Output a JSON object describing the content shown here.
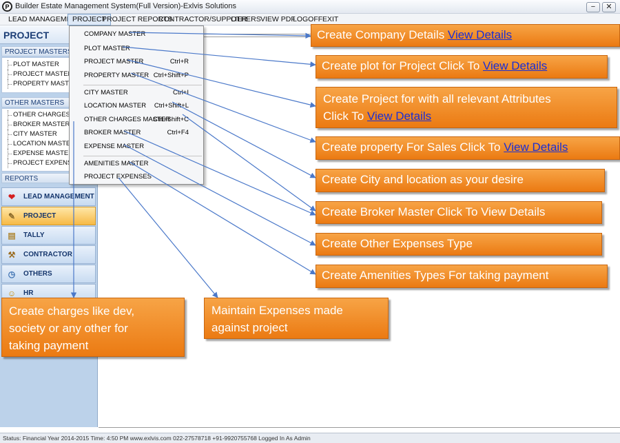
{
  "window": {
    "title": "Builder Estate Management System(Full Version)-Exlvis Solutions",
    "logo_glyph": "P",
    "minimize_glyph": "−",
    "close_glyph": "✕"
  },
  "menubar": {
    "items": [
      "LEAD MANAGEMENT",
      "PROJECT",
      "PROJECT REPORTS",
      "CONTRACTOR/SUPPLIER",
      "OTHERS",
      "VIEW PDF",
      "LOGOFF",
      "EXIT"
    ],
    "active": "PROJECT"
  },
  "sidebar": {
    "header": "PROJECT",
    "project_masters_label": "PROJECT MASTERS",
    "project_masters": [
      "PLOT MASTER",
      "PROJECT MASTER",
      "PROPERTY MASTER"
    ],
    "other_masters_label": "OTHER MASTERS",
    "other_masters": [
      "OTHER CHARGES MA",
      "BROKER MASTER",
      "CITY MASTER",
      "LOCATION MASTER",
      "EXPENSE MASTER",
      "PROJECT EXPENSES"
    ],
    "reports_label": "REPORTS",
    "nav": [
      {
        "label": "LEAD MANAGEMENT",
        "icon": "heart-icon",
        "glyph": "❤",
        "color": "#d42020"
      },
      {
        "label": "PROJECT",
        "icon": "tools-icon",
        "glyph": "✎",
        "color": "#8a6a2a"
      },
      {
        "label": "TALLY",
        "icon": "book-icon",
        "glyph": "▤",
        "color": "#b08a3a"
      },
      {
        "label": "CONTRACTOR",
        "icon": "hammer-icon",
        "glyph": "⚒",
        "color": "#9a6b1e"
      },
      {
        "label": "OTHERS",
        "icon": "clock-icon",
        "glyph": "◷",
        "color": "#3a6fb0"
      },
      {
        "label": "HR",
        "icon": "people-icon",
        "glyph": "☺",
        "color": "#c58a00"
      }
    ],
    "active_nav": "PROJECT"
  },
  "dropdown": {
    "items": [
      {
        "label": "COMPANY MASTER",
        "shortcut": ""
      },
      {
        "label": "PLOT MASTER",
        "shortcut": ""
      },
      {
        "label": "PROJECT MASTER",
        "shortcut": "Ctrl+R"
      },
      {
        "label": "PROPERTY MASTER",
        "shortcut": "Ctrl+Shift+P"
      },
      {
        "label": "CITY MASTER",
        "shortcut": "Ctrl+I"
      },
      {
        "label": "LOCATION MASTER",
        "shortcut": "Ctrl+Shift+L"
      },
      {
        "label": "OTHER CHARGES MASTER",
        "shortcut": "Ctrl+Shift+C"
      },
      {
        "label": "BROKER MASTER",
        "shortcut": "Ctrl+F4"
      },
      {
        "label": "EXPENSE MASTER",
        "shortcut": ""
      },
      {
        "label": "AMENITIES MASTER",
        "shortcut": ""
      },
      {
        "label": "PROJECT EXPENSES",
        "shortcut": ""
      }
    ]
  },
  "callouts": {
    "company": {
      "text": "Create Company Details ",
      "link": "View Details"
    },
    "plot": {
      "text": "Create plot for Project Click To ",
      "link": "View Details"
    },
    "project": {
      "line1": "Create Project for  with all relevant Attributes",
      "line2": "Click To ",
      "link": "View Details"
    },
    "property": {
      "text": "Create property For Sales Click To ",
      "link": "View Details"
    },
    "city": {
      "text": "Create City and location  as your desire"
    },
    "broker": {
      "text": "Create Broker Master Click To  View Details"
    },
    "other_expenses": {
      "text": "Create Other Expenses Type"
    },
    "amenities": {
      "text": "Create  Amenities Types For taking payment"
    },
    "charges": {
      "line1": "Create charges like dev,",
      "line2": "society or any other for",
      "line3": "taking  payment"
    },
    "expenses": {
      "line1": "Maintain Expenses made",
      "line2": "against project"
    }
  },
  "statusbar": {
    "text": "Status: Financial Year 2014-2015  Time: 4:50 PM  www.exlvis.com  022-27578718  +91-9920755768  Logged In As Admin"
  },
  "colors": {
    "callout_orange": "#eb7a12",
    "link_blue": "#1a2fd6",
    "arrow_blue": "#4a78c9",
    "sidebar_blue": "#bcd2ea"
  }
}
